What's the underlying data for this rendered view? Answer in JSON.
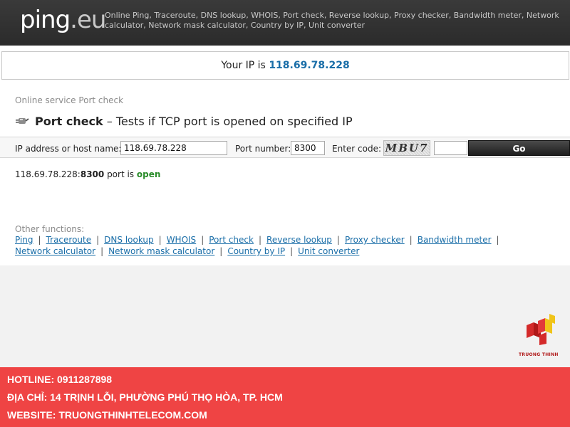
{
  "header": {
    "logo_main": "ping",
    "logo_ext": ".eu",
    "description": "Online Ping, Traceroute, DNS lookup, WHOIS, Port check, Reverse lookup, Proxy checker, Bandwidth meter, Network calculator, Network mask calculator, Country by IP, Unit converter"
  },
  "ip_banner": {
    "label": "Your IP is",
    "value": "118.69.78.228"
  },
  "page": {
    "breadcrumb": "Online service Port check",
    "title_strong": "Port check",
    "title_rest": " – Tests if TCP port is opened on specified IP"
  },
  "form": {
    "host_label": "IP address or host name:",
    "host_value": "118.69.78.228",
    "port_label": "Port number:",
    "port_value": "8300",
    "code_label": "Enter code:",
    "captcha_text": "MBU7",
    "code_value": "",
    "go_label": "Go"
  },
  "result": {
    "host": "118.69.78.228:",
    "port": "8300",
    "middle": " port is ",
    "status": "open"
  },
  "other_functions": {
    "label": "Other functions:",
    "links": [
      "Ping",
      "Traceroute",
      "DNS lookup",
      "WHOIS",
      "Port check",
      "Reverse lookup",
      "Proxy checker",
      "Bandwidth meter",
      "Network calculator",
      "Network mask calculator",
      "Country by IP",
      "Unit converter"
    ]
  },
  "brand": {
    "name": "TRUONG THINH"
  },
  "footer": {
    "hotline": "HOTLINE: 0911287898",
    "address": "ĐỊA CHỈ: 14 TRỊNH LỖI, PHƯỜNG PHÚ THỌ HÒA, TP. HCM",
    "website": "WEBSITE: TRUONGTHINHTELECOM.COM"
  },
  "colors": {
    "header_bg": "#2f2f2f",
    "link": "#1a6ea8",
    "status_open": "#2a8c2a",
    "footer_bg": "#ef4444"
  }
}
